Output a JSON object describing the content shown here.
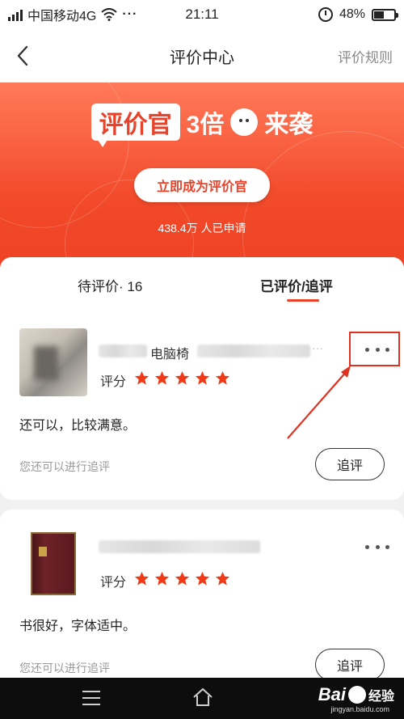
{
  "status_bar": {
    "carrier": "中国移动4G",
    "more": "···",
    "time": "21:11",
    "battery": "48%",
    "battery_level": 0.48
  },
  "nav": {
    "title": "评价中心",
    "rules_link": "评价规则"
  },
  "banner": {
    "badge": "评价官",
    "multiplier": "3倍",
    "tagline": "来袭",
    "cta_label": "立即成为评价官",
    "applied_count": "438.4万 人已申请"
  },
  "tabs": [
    {
      "label": "待评价· 16",
      "active": false
    },
    {
      "label": "已评价/追评",
      "active": true
    }
  ],
  "reviews": [
    {
      "product_name": "电脑椅",
      "rating_label": "评分",
      "stars": 5,
      "text": "还可以，比较满意。",
      "followup_hint": "您还可以进行追评",
      "followup_button": "追评"
    },
    {
      "product_name": "",
      "rating_label": "评分",
      "stars": 5,
      "text": "书很好，字体适中。",
      "followup_hint": "您还可以进行追评",
      "followup_button": "追评"
    }
  ],
  "watermark": {
    "brand": "Bai",
    "sub": "经验",
    "url": "jingyan.baidu.com"
  },
  "colors": {
    "accent": "#e8432a",
    "star": "#f03a17",
    "banner_top": "#ff7a5a",
    "banner_bottom": "#ee4124"
  }
}
